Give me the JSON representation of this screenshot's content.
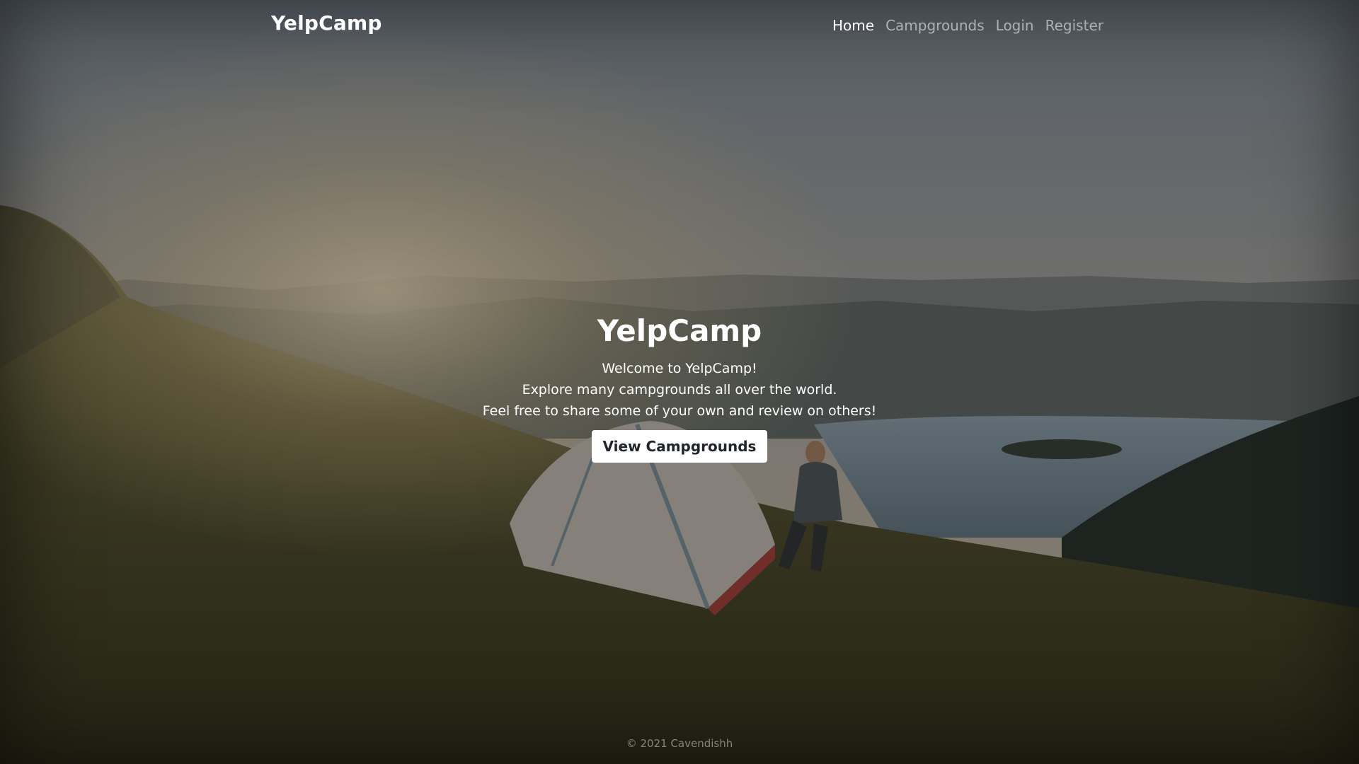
{
  "navbar": {
    "brand": "YelpCamp",
    "links": [
      {
        "label": "Home",
        "active": true
      },
      {
        "label": "Campgrounds",
        "active": false
      },
      {
        "label": "Login",
        "active": false
      },
      {
        "label": "Register",
        "active": false
      }
    ]
  },
  "hero": {
    "title": "YelpCamp",
    "lines": [
      "Welcome to YelpCamp!",
      "Explore many campgrounds all over the world.",
      "Feel free to share some of your own and review on others!"
    ],
    "button_label": "View Campgrounds"
  },
  "footer": {
    "text": "© 2021 Cavendishh"
  },
  "colors": {
    "overlay": "#000000",
    "button_bg": "#ffffff",
    "button_text": "#212529",
    "nav_active": "#ffffff"
  }
}
